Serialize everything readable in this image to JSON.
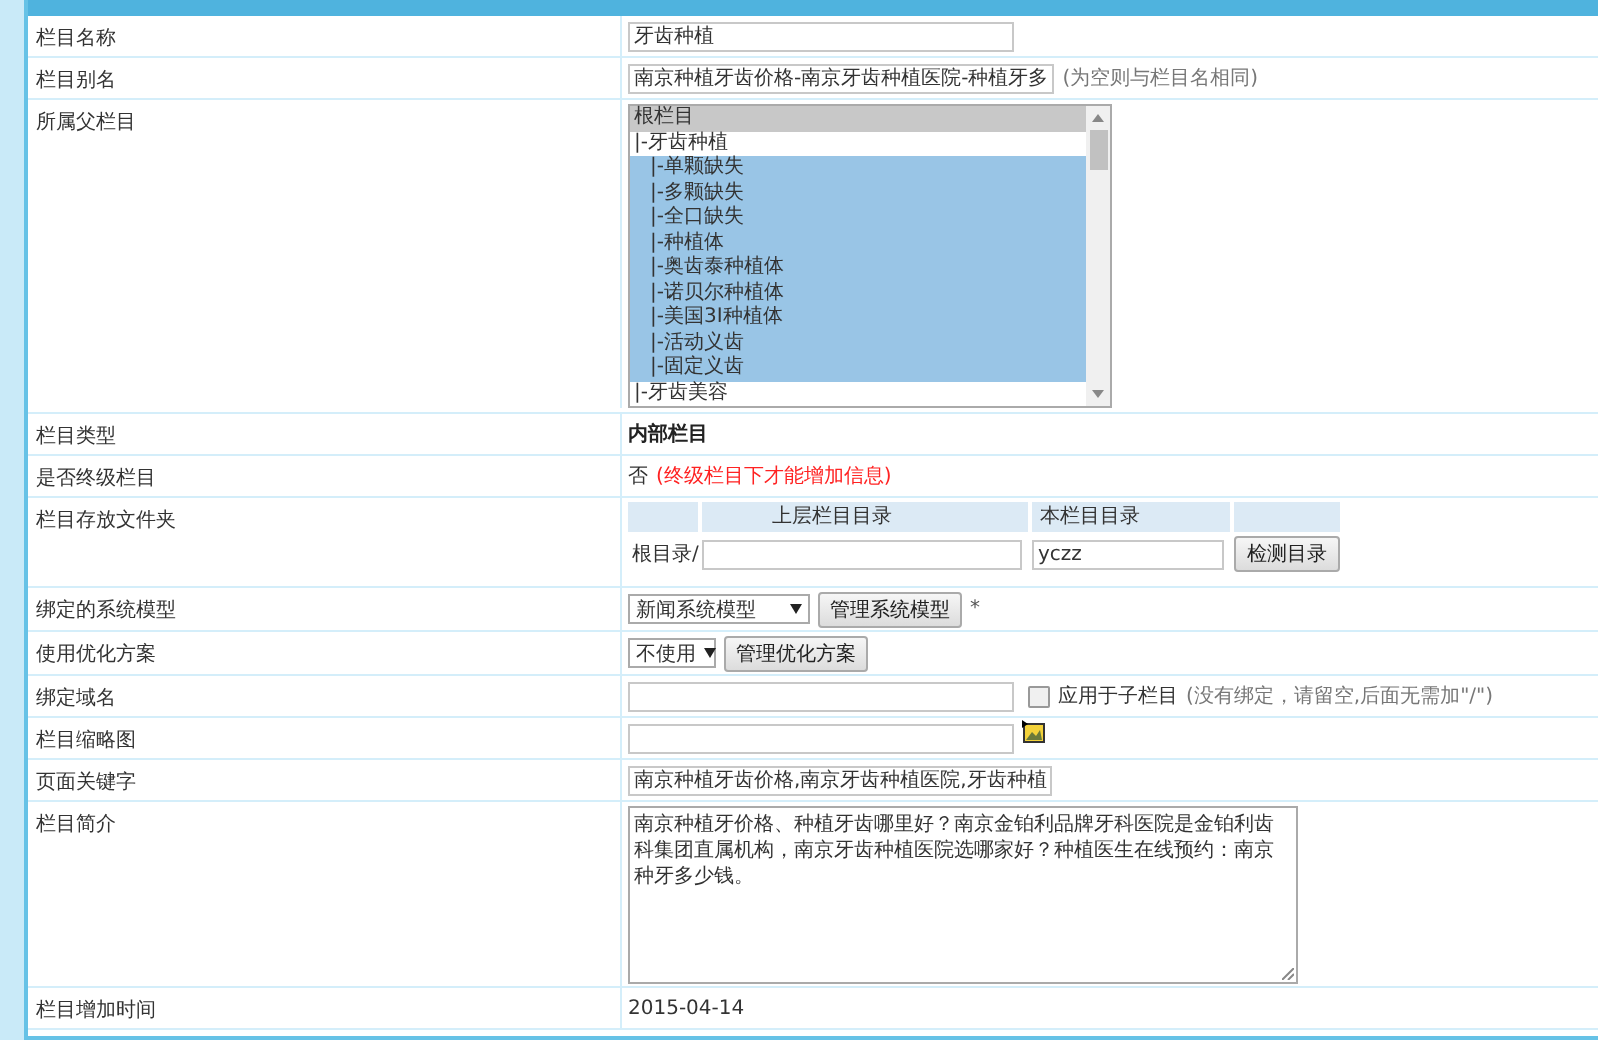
{
  "rows": [
    {
      "label": "栏目名称",
      "kind": "input",
      "value": "牙齿种植"
    },
    {
      "label": "栏目别名",
      "kind": "input",
      "value": "南京种植牙齿价格-南京牙齿种植医院-种植牙多",
      "note": "(为空则与栏目名相同)"
    },
    {
      "label": "所属父栏目",
      "kind": "listbox",
      "options": [
        {
          "label": "根栏目",
          "highlighted": true,
          "selected": false
        },
        {
          "label": "|-牙齿种植",
          "highlighted": false,
          "selected": false,
          "children": [
            {
              "label": "|-单颗缺失",
              "highlighted": false,
              "selected": true
            },
            {
              "label": "|-多颗缺失",
              "highlighted": false,
              "selected": true
            },
            {
              "label": "|-全口缺失",
              "highlighted": false,
              "selected": true
            },
            {
              "label": "|-种植体",
              "highlighted": false,
              "selected": true
            },
            {
              "label": "|-奥齿泰种植体",
              "highlighted": false,
              "selected": true
            },
            {
              "label": "|-诺贝尔种植体",
              "highlighted": false,
              "selected": true
            },
            {
              "label": "|-美国3I种植体",
              "highlighted": false,
              "selected": true
            },
            {
              "label": "|-活动义齿",
              "highlighted": false,
              "selected": true
            },
            {
              "label": "|-固定义齿",
              "highlighted": false,
              "selected": true
            }
          ]
        },
        {
          "label": "|-牙齿美容",
          "highlighted": false,
          "selected": false
        }
      ]
    },
    {
      "label": "栏目类型",
      "kind": "bold",
      "value": "内部栏目"
    },
    {
      "label": "是否终级栏目",
      "kind": "flag",
      "value": "否",
      "note": "(终级栏目下才能增加信息)"
    },
    {
      "label": "栏目存放文件夹",
      "kind": "folder",
      "headers": [
        "上层栏目目录",
        "本栏目目录"
      ],
      "prefix": "根目录/",
      "value": "yczz",
      "button": "检测目录"
    },
    {
      "label": "绑定的系统模型",
      "kind": "select",
      "value": "新闻系统模型",
      "button": "管理系统模型",
      "note": "*"
    },
    {
      "label": "使用优化方案",
      "kind": "select",
      "value": "不使用",
      "button": "管理优化方案"
    },
    {
      "label": "绑定域名",
      "kind": "domain",
      "checkbox": {
        "label": "应用于子栏目",
        "checked": false
      },
      "note": "(没有绑定，请留空,后面无需加\"/\")"
    },
    {
      "label": "栏目缩略图",
      "kind": "image"
    },
    {
      "label": "页面关键字",
      "kind": "input",
      "value": "南京种植牙齿价格,南京牙齿种植医院,牙齿种植"
    },
    {
      "label": "栏目简介",
      "kind": "textarea",
      "value": "南京种植牙价格、种植牙齿哪里好？南京金铂利品牌牙科医院是金铂利齿科集团直属机构，南京牙齿种植医院选哪家好？种植医生在线预约：南京种牙多少钱。"
    },
    {
      "label": "栏目增加时间",
      "kind": "plain",
      "value": "2015-04-14"
    }
  ]
}
